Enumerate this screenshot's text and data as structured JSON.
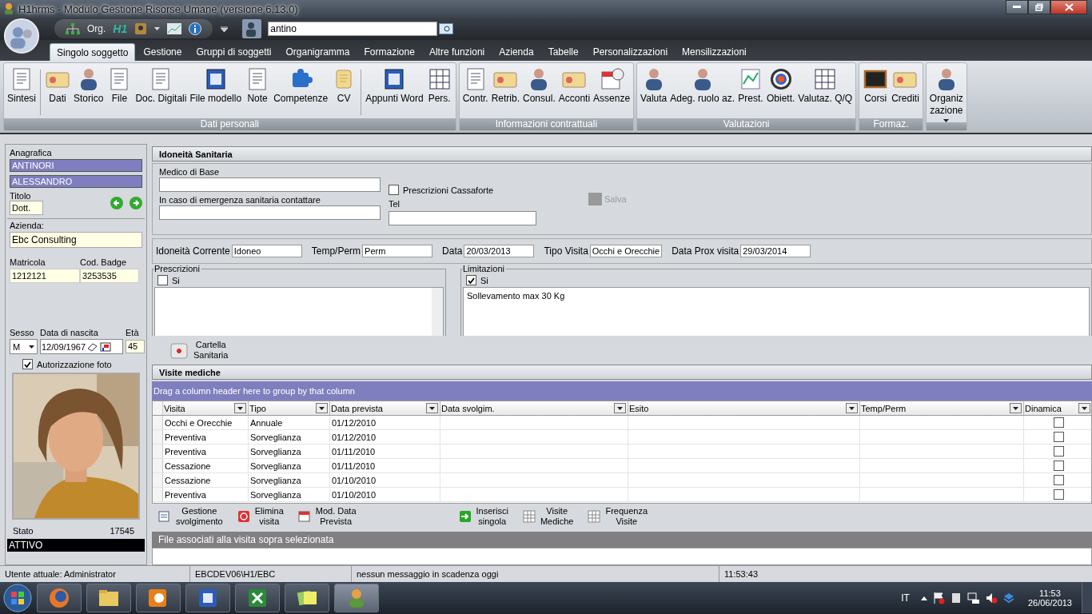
{
  "window": {
    "title": "H1hrms - Modulo Gestione Risorse Umane (versione 6.13.0)"
  },
  "quick_toolbar": {
    "org_label": "Org.",
    "logo": "H1",
    "search": {
      "value": "antino"
    }
  },
  "tabs": [
    {
      "label": "Singolo soggetto",
      "selected": true
    },
    {
      "label": "Gestione",
      "selected": false
    },
    {
      "label": "Gruppi di soggetti",
      "selected": false
    },
    {
      "label": "Organigramma",
      "selected": false
    },
    {
      "label": "Formazione",
      "selected": false
    },
    {
      "label": "Altre funzioni",
      "selected": false
    },
    {
      "label": "Azienda",
      "selected": false
    },
    {
      "label": "Tabelle",
      "selected": false
    },
    {
      "label": "Personalizzazioni",
      "selected": false
    },
    {
      "label": "Mensilizzazioni",
      "selected": false
    }
  ],
  "ribbon": {
    "groups": [
      {
        "label": "Dati personali",
        "buttons": [
          {
            "lines": [
              "Sintesi"
            ],
            "separator_after": true
          },
          {
            "lines": [
              "Dati"
            ]
          },
          {
            "lines": [
              "Storico"
            ]
          },
          {
            "lines": [
              "File"
            ]
          },
          {
            "lines": [
              "Doc. Digitali"
            ]
          },
          {
            "lines": [
              "File modello"
            ]
          },
          {
            "lines": [
              "Note"
            ]
          },
          {
            "lines": [
              "Competenze"
            ]
          },
          {
            "lines": [
              "CV"
            ],
            "separator_after": true
          },
          {
            "lines": [
              "Appunti Word"
            ]
          },
          {
            "lines": [
              "Pers."
            ]
          }
        ]
      },
      {
        "label": "Informazioni contrattuali",
        "buttons": [
          {
            "lines": [
              "Contr."
            ]
          },
          {
            "lines": [
              "Retrib."
            ]
          },
          {
            "lines": [
              "Consul."
            ]
          },
          {
            "lines": [
              "Acconti"
            ]
          },
          {
            "lines": [
              "Assenze"
            ]
          }
        ]
      },
      {
        "label": "Valutazioni",
        "buttons": [
          {
            "lines": [
              "Valuta"
            ]
          },
          {
            "lines": [
              "Adeg. ruolo az."
            ]
          },
          {
            "lines": [
              "Prest."
            ]
          },
          {
            "lines": [
              "Obiett."
            ]
          },
          {
            "lines": [
              "Valutaz. Q/Q"
            ]
          }
        ]
      },
      {
        "label": "Formaz.",
        "buttons": [
          {
            "lines": [
              "Corsi"
            ]
          },
          {
            "lines": [
              "Crediti"
            ]
          }
        ]
      },
      {
        "buttons": [
          {
            "lines": [
              "Organiz",
              "zazione"
            ],
            "dropdown": true
          }
        ]
      }
    ]
  },
  "person": {
    "section_label": "Anagrafica",
    "surname": "ANTINORI",
    "name": "ALESSANDRO",
    "title_label": "Titolo",
    "title": "Dott.",
    "company_label": "Azienda:",
    "company": "Ebc Consulting",
    "matricola_label": "Matricola",
    "matricola": "1212121",
    "badge_label": "Cod. Badge",
    "badge": "3253535",
    "sex_label": "Sesso",
    "sex": "M",
    "birth_label": "Data di nascita",
    "birth": "12/09/1967",
    "age_label": "Età",
    "age": "45",
    "photo_auth": {
      "label": "Autorizzazione foto",
      "checked": true
    },
    "status_label": "Stato",
    "number": "17545",
    "status": "ATTIVO"
  },
  "health": {
    "title": "Idoneità Sanitaria",
    "doctor_label": "Medico di Base",
    "safe": {
      "label": "Prescrizioni Cassaforte",
      "checked": false
    },
    "save": {
      "label": "Salva",
      "disabled": true
    },
    "emergency_label": "In caso di emergenza sanitaria contattare",
    "tel_label": "Tel",
    "fitness": [
      {
        "label": "Idoneità Corrente",
        "value": "Idoneo"
      },
      {
        "label": "Temp/Perm",
        "value": "Perm"
      },
      {
        "label": "Data",
        "value": "20/03/2013"
      },
      {
        "label": "Tipo Visita",
        "value": "Occhi e Orecchie"
      },
      {
        "label": "Data Prox visita",
        "value": "29/03/2014"
      }
    ],
    "prescriptions": {
      "label": "Prescrizioni",
      "check_label": "Si",
      "checked": false
    },
    "limitations": {
      "label": "Limitazioni",
      "check_label": "Si",
      "checked": true,
      "text": "Sollevamento max 30 Kg"
    },
    "record_button": [
      "Cartella",
      "Sanitaria"
    ]
  },
  "visits": {
    "title": "Visite mediche",
    "group_hint": "Drag a column header here to group by that column",
    "columns": [
      "Visita",
      "Tipo",
      "Data prevista",
      "Data svolgim.",
      "Esito",
      "Temp/Perm",
      "Dinamica"
    ],
    "rows": [
      {
        "cells": [
          "Occhi e Orecchie",
          "Annuale",
          "01/12/2010"
        ],
        "dinamica": false
      },
      {
        "cells": [
          "Preventiva",
          "Sorveglianza",
          "01/12/2010"
        ],
        "dinamica": false
      },
      {
        "cells": [
          "Preventiva",
          "Sorveglianza",
          "01/11/2010"
        ],
        "dinamica": false
      },
      {
        "cells": [
          "Cessazione",
          "Sorveglianza",
          "01/11/2010"
        ],
        "dinamica": false
      },
      {
        "cells": [
          "Cessazione",
          "Sorveglianza",
          "01/10/2010"
        ],
        "dinamica": false
      },
      {
        "cells": [
          "Preventiva",
          "Sorveglianza",
          "01/10/2010"
        ],
        "dinamica": false
      }
    ],
    "actions": [
      {
        "lines": [
          "Gestione",
          "svolgimento"
        ]
      },
      {
        "lines": [
          "Elimina",
          "visita"
        ]
      },
      {
        "lines": [
          "Mod. Data",
          "Prevista"
        ]
      },
      {
        "lines": [
          "Inserisci",
          "singola"
        ]
      },
      {
        "lines": [
          "Visite",
          "Mediche"
        ]
      },
      {
        "lines": [
          "Frequenza",
          "Visite"
        ]
      }
    ],
    "files_title": "File associati alla visita sopra selezionata"
  },
  "status_bar": [
    "Utente attuale: Administrator",
    "EBCDEV06\\H1/EBC",
    "nessun messaggio in scadenza oggi",
    "11:53:43"
  ],
  "taskbar": {
    "language": "IT",
    "time": "11:53",
    "date": "26/06/2013"
  }
}
